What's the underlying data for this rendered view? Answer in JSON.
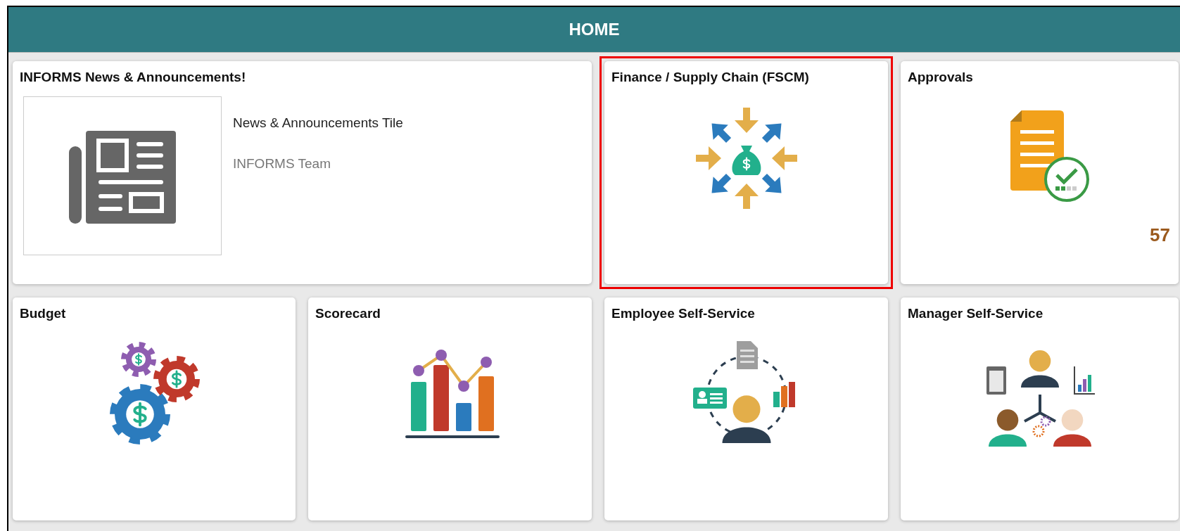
{
  "header": {
    "title": "HOME"
  },
  "tiles": [
    {
      "kind": "news",
      "title": "INFORMS News & Announcements!",
      "highlighted": false,
      "headline": "News & Announcements Tile",
      "author": "INFORMS Team"
    },
    {
      "kind": "finance",
      "title": "Finance / Supply Chain (FSCM)",
      "highlighted": true
    },
    {
      "kind": "approvals",
      "title": "Approvals",
      "highlighted": false,
      "count": "57"
    },
    {
      "kind": "budget",
      "title": "Budget",
      "highlighted": false
    },
    {
      "kind": "scorecard",
      "title": "Scorecard",
      "highlighted": false
    },
    {
      "kind": "employee",
      "title": "Employee Self-Service",
      "highlighted": false
    },
    {
      "kind": "manager",
      "title": "Manager Self-Service",
      "highlighted": false
    }
  ]
}
